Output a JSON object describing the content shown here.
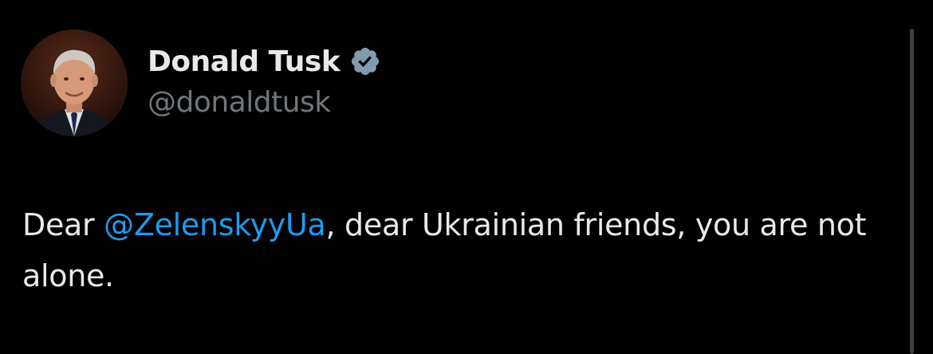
{
  "author": {
    "display_name": "Donald Tusk",
    "handle": "@donaldtusk",
    "verified": true,
    "verified_icon": "verified-badge-icon",
    "avatar": "profile-photo"
  },
  "tweet": {
    "text_before": "Dear ",
    "mention": "@ZelenskyyUa",
    "text_after": ", dear Ukrainian friends, you are not alone."
  },
  "colors": {
    "background": "#000000",
    "text": "#e7e9ea",
    "secondary_text": "#71767b",
    "link": "#1d9bf0",
    "verified_badge": "#829aab"
  }
}
